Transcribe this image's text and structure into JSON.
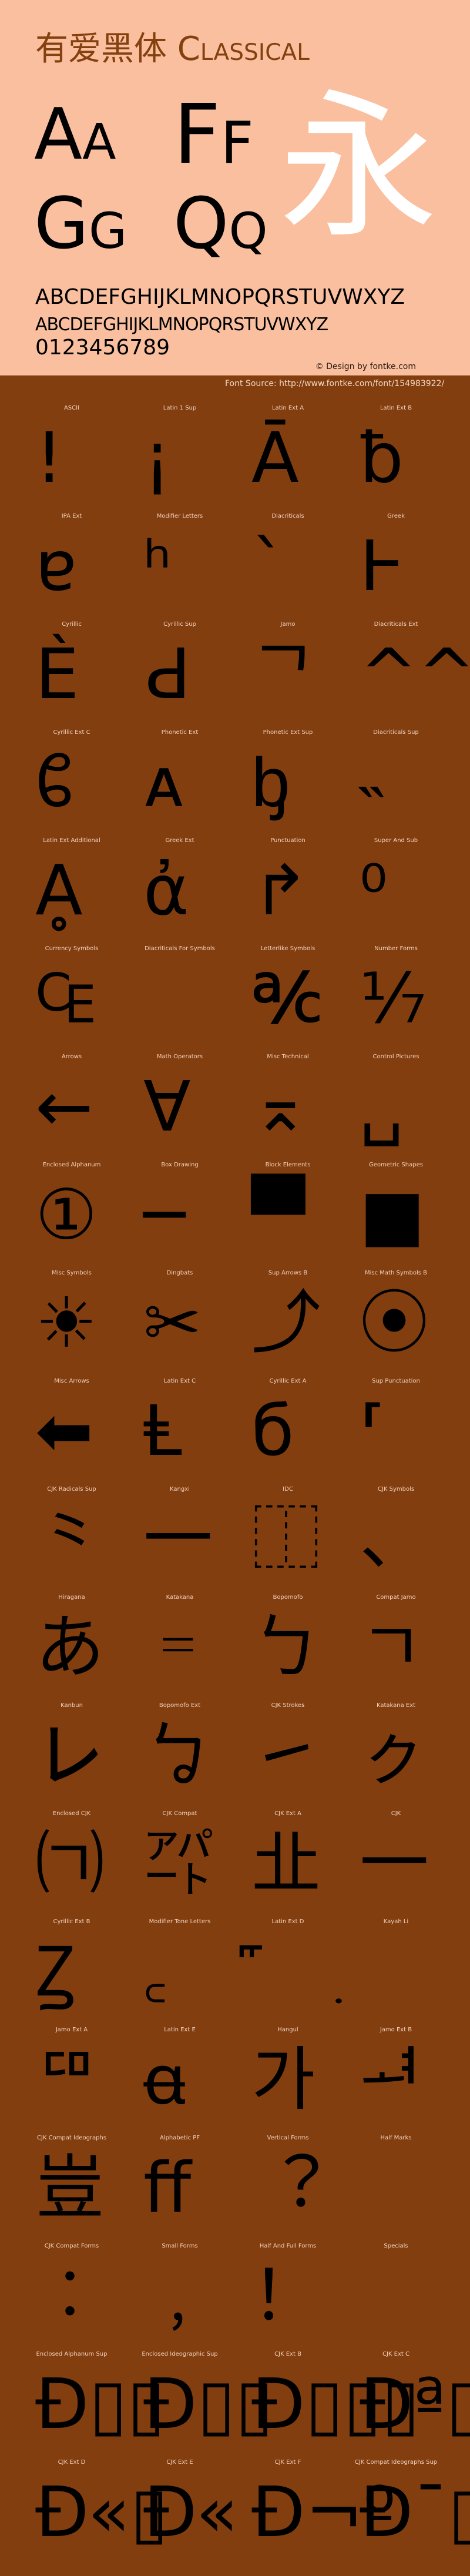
{
  "colors": {
    "header_bg": "#f9bf9f",
    "body_bg": "#833e10",
    "title": "#84400f",
    "label": "#f1d3bd"
  },
  "header": {
    "title": "有爱黑体 Classical",
    "pairs": [
      "Aa",
      "Ff",
      "Gg",
      "Qq"
    ],
    "hero_glyph": "永",
    "uppercase": "ABCDEFGHIJKLMNOPQRSTUVWXYZ",
    "smallcaps": "ABCDEFGHIJKLMNOPQRSTUVWXYZ",
    "digits": "0123456789",
    "credit": "© Design by fontke.com"
  },
  "source": "Font Source: http://www.fontke.com/font/154983922/",
  "blocks": [
    {
      "label": "ASCII",
      "glyph": "!"
    },
    {
      "label": "Latin 1 Sup",
      "glyph": "¡"
    },
    {
      "label": "Latin Ext A",
      "glyph": "Ā"
    },
    {
      "label": "Latin Ext B",
      "glyph": "ƀ"
    },
    {
      "label": "IPA Ext",
      "glyph": "ɐ"
    },
    {
      "label": "Modifier Letters",
      "glyph": "ʰ"
    },
    {
      "label": "Diacriticals",
      "glyph": "`"
    },
    {
      "label": "Greek",
      "glyph": "Ͱ"
    },
    {
      "label": "Cyrillic",
      "glyph": "Ѐ"
    },
    {
      "label": "Cyrillic Sup",
      "glyph": "Ԁ"
    },
    {
      "label": "Jamo",
      "glyph": "ᄀ"
    },
    {
      "label": "Diacriticals Ext",
      "glyph": "^^"
    },
    {
      "label": "Cyrillic Ext C",
      "glyph": "ᲀ"
    },
    {
      "label": "Phonetic Ext",
      "glyph": "ᴀ"
    },
    {
      "label": "Phonetic Ext Sup",
      "glyph": "ᶀ"
    },
    {
      "label": "Diacriticals Sup",
      "glyph": "˵"
    },
    {
      "label": "Latin Ext Additional",
      "glyph": "Ḁ"
    },
    {
      "label": "Greek Ext",
      "glyph": "ἀ"
    },
    {
      "label": "Punctuation",
      "glyph": "↱"
    },
    {
      "label": "Super And Sub",
      "glyph": "⁰"
    },
    {
      "label": "Currency Symbols",
      "glyph": "₠"
    },
    {
      "label": "Diacriticals For Symbols",
      "glyph": ""
    },
    {
      "label": "Letterlike Symbols",
      "glyph": "℀"
    },
    {
      "label": "Number Forms",
      "glyph": "⅐"
    },
    {
      "label": "Arrows",
      "glyph": "←"
    },
    {
      "label": "Math Operators",
      "glyph": "∀"
    },
    {
      "label": "Misc Technical",
      "glyph": "⌅"
    },
    {
      "label": "Control Pictures",
      "glyph": "␣"
    },
    {
      "label": "Enclosed Alphanum",
      "glyph": "①"
    },
    {
      "label": "Box Drawing",
      "glyph": "─"
    },
    {
      "label": "Block Elements",
      "glyph": "▀"
    },
    {
      "label": "Geometric Shapes",
      "glyph": "■"
    },
    {
      "label": "Misc Symbols",
      "glyph": "☀"
    },
    {
      "label": "Dingbats",
      "glyph": "✂"
    },
    {
      "label": "Sup Arrows B",
      "glyph": "⤴"
    },
    {
      "label": "Misc Math Symbols B",
      "glyph": "⦿"
    },
    {
      "label": "Misc Arrows",
      "glyph": "⬅"
    },
    {
      "label": "Latin Ext C",
      "glyph": "Ⱡ"
    },
    {
      "label": "Cyrillic Ext A",
      "glyph": "б"
    },
    {
      "label": "Sup Punctuation",
      "glyph": "⸢"
    },
    {
      "label": "CJK Radicals Sup",
      "glyph": "⺀"
    },
    {
      "label": "Kangxi",
      "glyph": "⼀"
    },
    {
      "label": "IDC",
      "glyph": "⿰"
    },
    {
      "label": "CJK Symbols",
      "glyph": "、"
    },
    {
      "label": "Hiragana",
      "glyph": "あ"
    },
    {
      "label": "Katakana",
      "glyph": "゠"
    },
    {
      "label": "Bopomofo",
      "glyph": "ㄅ"
    },
    {
      "label": "Compat Jamo",
      "glyph": "ㄱ"
    },
    {
      "label": "Kanbun",
      "glyph": "㆑"
    },
    {
      "label": "Bopomofo Ext",
      "glyph": "ㆠ"
    },
    {
      "label": "CJK Strokes",
      "glyph": "㇀"
    },
    {
      "label": "Katakana Ext",
      "glyph": "ㇰ"
    },
    {
      "label": "Enclosed CJK",
      "glyph": "㈀"
    },
    {
      "label": "CJK Compat",
      "glyph": "㌀"
    },
    {
      "label": "CJK Ext A",
      "glyph": "㐀"
    },
    {
      "label": "CJK",
      "glyph": "一"
    },
    {
      "label": "Cyrillic Ext B",
      "glyph": "Ꙁ"
    },
    {
      "label": "Modifier Tone Letters",
      "glyph": "꜀"
    },
    {
      "label": "Latin Ext D",
      "glyph": "꜠"
    },
    {
      "label": "Kayah Li",
      "glyph": "꤫"
    },
    {
      "label": "Jamo Ext A",
      "glyph": "ꥠ"
    },
    {
      "label": "Latin Ext E",
      "glyph": "ꬰ"
    },
    {
      "label": "Hangul",
      "glyph": "가"
    },
    {
      "label": "Jamo Ext B",
      "glyph": "ힰ"
    },
    {
      "label": "CJK Compat Ideographs",
      "glyph": "豈"
    },
    {
      "label": "Alphabetic PF",
      "glyph": "ﬀ"
    },
    {
      "label": "Vertical Forms",
      "glyph": "︖"
    },
    {
      "label": "Half Marks",
      "glyph": ""
    },
    {
      "label": "CJK Compat Forms",
      "glyph": "︰"
    },
    {
      "label": "Small Forms",
      "glyph": "﹐"
    },
    {
      "label": "Half And Full Forms",
      "glyph": "！"
    },
    {
      "label": "Specials",
      "glyph": "￼"
    },
    {
      "label": "Enclosed Alphanum Sup",
      "glyph": "Ð▯▯"
    },
    {
      "label": "Enclosed Ideographic Sup",
      "glyph": "Ð▯▯"
    },
    {
      "label": "CJK Ext B",
      "glyph": "Ð▯▯▯"
    },
    {
      "label": "CJK Ext C",
      "glyph": "Ðª▯"
    },
    {
      "label": "CJK Ext D",
      "glyph": "Ð«▯"
    },
    {
      "label": "CJK Ext E",
      "glyph": "Ð«"
    },
    {
      "label": "CJK Ext F",
      "glyph": "Ð¬º"
    },
    {
      "label": "CJK Compat Ideographs Sup",
      "glyph": "Ð¯▯"
    }
  ]
}
